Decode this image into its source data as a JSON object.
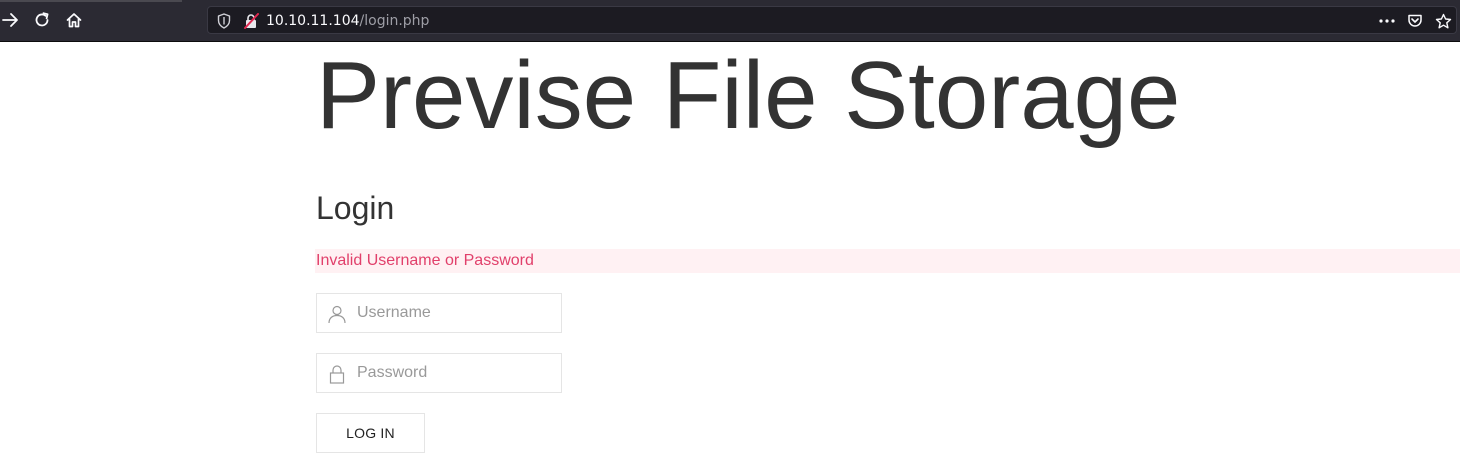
{
  "browser": {
    "url_host": "10.10.11.104",
    "url_path": "/login.php",
    "icons": {
      "forward": "arrow-right-icon",
      "reload": "reload-icon",
      "home": "home-icon",
      "tracking": "shield-icon",
      "insecure": "insecure-lock-icon",
      "more": "more-options-icon",
      "pocket": "pocket-icon",
      "bookmark": "star-icon"
    }
  },
  "page": {
    "site_title": "Previse File Storage",
    "login_heading": "Login",
    "error_message": "Invalid Username or Password",
    "username_placeholder": "Username",
    "username_value": "",
    "password_placeholder": "Password",
    "password_value": "",
    "login_button": "LOG IN"
  },
  "colors": {
    "chrome_bg": "#2b2a33",
    "urlbar_bg": "#1c1b22",
    "error_text": "#e1406b",
    "error_bg": "#fff1f3",
    "title_text": "#333333"
  }
}
